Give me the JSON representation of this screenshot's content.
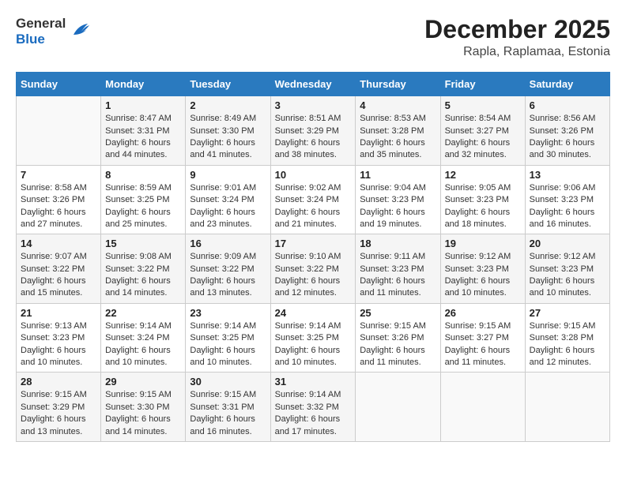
{
  "header": {
    "logo_line1": "General",
    "logo_line2": "Blue",
    "month": "December 2025",
    "location": "Rapla, Raplamaa, Estonia"
  },
  "weekdays": [
    "Sunday",
    "Monday",
    "Tuesday",
    "Wednesday",
    "Thursday",
    "Friday",
    "Saturday"
  ],
  "weeks": [
    [
      {
        "day": "",
        "sunrise": "",
        "sunset": "",
        "daylight": ""
      },
      {
        "day": "1",
        "sunrise": "Sunrise: 8:47 AM",
        "sunset": "Sunset: 3:31 PM",
        "daylight": "Daylight: 6 hours and 44 minutes."
      },
      {
        "day": "2",
        "sunrise": "Sunrise: 8:49 AM",
        "sunset": "Sunset: 3:30 PM",
        "daylight": "Daylight: 6 hours and 41 minutes."
      },
      {
        "day": "3",
        "sunrise": "Sunrise: 8:51 AM",
        "sunset": "Sunset: 3:29 PM",
        "daylight": "Daylight: 6 hours and 38 minutes."
      },
      {
        "day": "4",
        "sunrise": "Sunrise: 8:53 AM",
        "sunset": "Sunset: 3:28 PM",
        "daylight": "Daylight: 6 hours and 35 minutes."
      },
      {
        "day": "5",
        "sunrise": "Sunrise: 8:54 AM",
        "sunset": "Sunset: 3:27 PM",
        "daylight": "Daylight: 6 hours and 32 minutes."
      },
      {
        "day": "6",
        "sunrise": "Sunrise: 8:56 AM",
        "sunset": "Sunset: 3:26 PM",
        "daylight": "Daylight: 6 hours and 30 minutes."
      }
    ],
    [
      {
        "day": "7",
        "sunrise": "Sunrise: 8:58 AM",
        "sunset": "Sunset: 3:26 PM",
        "daylight": "Daylight: 6 hours and 27 minutes."
      },
      {
        "day": "8",
        "sunrise": "Sunrise: 8:59 AM",
        "sunset": "Sunset: 3:25 PM",
        "daylight": "Daylight: 6 hours and 25 minutes."
      },
      {
        "day": "9",
        "sunrise": "Sunrise: 9:01 AM",
        "sunset": "Sunset: 3:24 PM",
        "daylight": "Daylight: 6 hours and 23 minutes."
      },
      {
        "day": "10",
        "sunrise": "Sunrise: 9:02 AM",
        "sunset": "Sunset: 3:24 PM",
        "daylight": "Daylight: 6 hours and 21 minutes."
      },
      {
        "day": "11",
        "sunrise": "Sunrise: 9:04 AM",
        "sunset": "Sunset: 3:23 PM",
        "daylight": "Daylight: 6 hours and 19 minutes."
      },
      {
        "day": "12",
        "sunrise": "Sunrise: 9:05 AM",
        "sunset": "Sunset: 3:23 PM",
        "daylight": "Daylight: 6 hours and 18 minutes."
      },
      {
        "day": "13",
        "sunrise": "Sunrise: 9:06 AM",
        "sunset": "Sunset: 3:23 PM",
        "daylight": "Daylight: 6 hours and 16 minutes."
      }
    ],
    [
      {
        "day": "14",
        "sunrise": "Sunrise: 9:07 AM",
        "sunset": "Sunset: 3:22 PM",
        "daylight": "Daylight: 6 hours and 15 minutes."
      },
      {
        "day": "15",
        "sunrise": "Sunrise: 9:08 AM",
        "sunset": "Sunset: 3:22 PM",
        "daylight": "Daylight: 6 hours and 14 minutes."
      },
      {
        "day": "16",
        "sunrise": "Sunrise: 9:09 AM",
        "sunset": "Sunset: 3:22 PM",
        "daylight": "Daylight: 6 hours and 13 minutes."
      },
      {
        "day": "17",
        "sunrise": "Sunrise: 9:10 AM",
        "sunset": "Sunset: 3:22 PM",
        "daylight": "Daylight: 6 hours and 12 minutes."
      },
      {
        "day": "18",
        "sunrise": "Sunrise: 9:11 AM",
        "sunset": "Sunset: 3:23 PM",
        "daylight": "Daylight: 6 hours and 11 minutes."
      },
      {
        "day": "19",
        "sunrise": "Sunrise: 9:12 AM",
        "sunset": "Sunset: 3:23 PM",
        "daylight": "Daylight: 6 hours and 10 minutes."
      },
      {
        "day": "20",
        "sunrise": "Sunrise: 9:12 AM",
        "sunset": "Sunset: 3:23 PM",
        "daylight": "Daylight: 6 hours and 10 minutes."
      }
    ],
    [
      {
        "day": "21",
        "sunrise": "Sunrise: 9:13 AM",
        "sunset": "Sunset: 3:23 PM",
        "daylight": "Daylight: 6 hours and 10 minutes."
      },
      {
        "day": "22",
        "sunrise": "Sunrise: 9:14 AM",
        "sunset": "Sunset: 3:24 PM",
        "daylight": "Daylight: 6 hours and 10 minutes."
      },
      {
        "day": "23",
        "sunrise": "Sunrise: 9:14 AM",
        "sunset": "Sunset: 3:25 PM",
        "daylight": "Daylight: 6 hours and 10 minutes."
      },
      {
        "day": "24",
        "sunrise": "Sunrise: 9:14 AM",
        "sunset": "Sunset: 3:25 PM",
        "daylight": "Daylight: 6 hours and 10 minutes."
      },
      {
        "day": "25",
        "sunrise": "Sunrise: 9:15 AM",
        "sunset": "Sunset: 3:26 PM",
        "daylight": "Daylight: 6 hours and 11 minutes."
      },
      {
        "day": "26",
        "sunrise": "Sunrise: 9:15 AM",
        "sunset": "Sunset: 3:27 PM",
        "daylight": "Daylight: 6 hours and 11 minutes."
      },
      {
        "day": "27",
        "sunrise": "Sunrise: 9:15 AM",
        "sunset": "Sunset: 3:28 PM",
        "daylight": "Daylight: 6 hours and 12 minutes."
      }
    ],
    [
      {
        "day": "28",
        "sunrise": "Sunrise: 9:15 AM",
        "sunset": "Sunset: 3:29 PM",
        "daylight": "Daylight: 6 hours and 13 minutes."
      },
      {
        "day": "29",
        "sunrise": "Sunrise: 9:15 AM",
        "sunset": "Sunset: 3:30 PM",
        "daylight": "Daylight: 6 hours and 14 minutes."
      },
      {
        "day": "30",
        "sunrise": "Sunrise: 9:15 AM",
        "sunset": "Sunset: 3:31 PM",
        "daylight": "Daylight: 6 hours and 16 minutes."
      },
      {
        "day": "31",
        "sunrise": "Sunrise: 9:14 AM",
        "sunset": "Sunset: 3:32 PM",
        "daylight": "Daylight: 6 hours and 17 minutes."
      },
      {
        "day": "",
        "sunrise": "",
        "sunset": "",
        "daylight": ""
      },
      {
        "day": "",
        "sunrise": "",
        "sunset": "",
        "daylight": ""
      },
      {
        "day": "",
        "sunrise": "",
        "sunset": "",
        "daylight": ""
      }
    ]
  ]
}
